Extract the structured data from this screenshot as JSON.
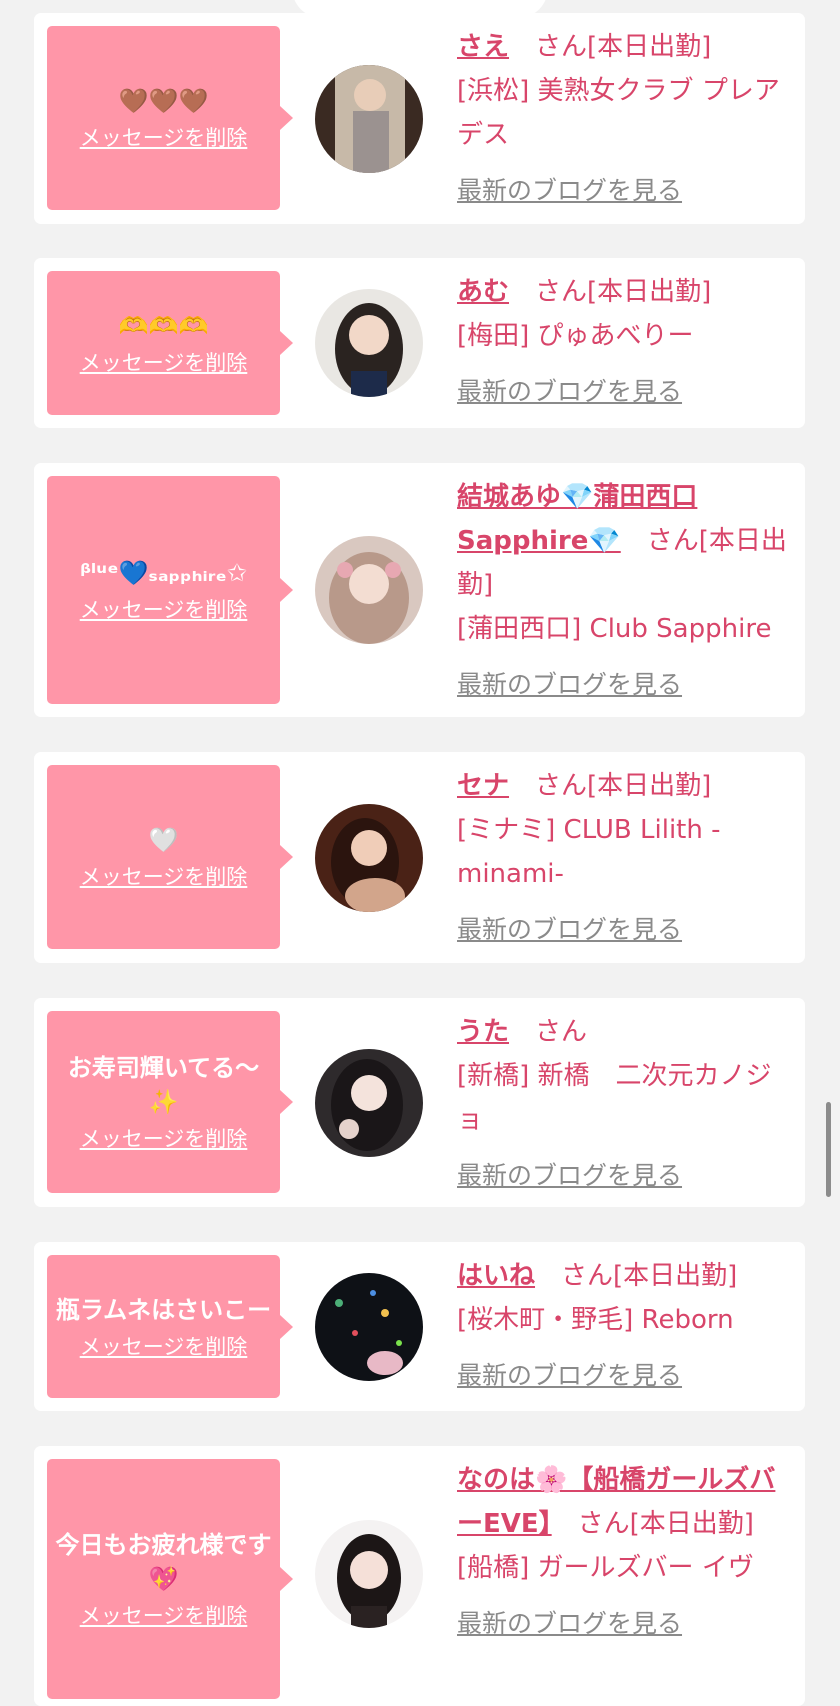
{
  "cards": [
    {
      "message": "🤎🤎🤎",
      "delete_label": "メッセージを削除",
      "name": "さえ",
      "suffix": "　さん[本日出勤]",
      "shop": "[浜松] 美熟女クラブ プレアデス",
      "blog_label": "最新のブログを見る"
    },
    {
      "message": "🫶🫶🫶",
      "delete_label": "メッセージを削除",
      "name": "あむ",
      "suffix": "　さん[本日出勤]",
      "shop": "[梅田] ぴゅあべりー",
      "blog_label": "最新のブログを見る"
    },
    {
      "message": "ᵝˡᵘᵉ💙ₛₐₚₚₕᵢᵣₑ✩",
      "delete_label": "メッセージを削除",
      "name": "結城あゆ💎蒲田西口Sapphire💎",
      "suffix": "　さん[本日出勤]",
      "shop": "[蒲田西口] Club Sapphire",
      "blog_label": "最新のブログを見る"
    },
    {
      "message": "🤍",
      "delete_label": "メッセージを削除",
      "name": "セナ",
      "suffix": "　さん[本日出勤]",
      "shop": "[ミナミ] CLUB Lilith -minami-",
      "blog_label": "最新のブログを見る"
    },
    {
      "message": "お寿司輝いてる〜✨",
      "delete_label": "メッセージを削除",
      "name": "うた",
      "suffix": "　さん",
      "shop": "[新橋] 新橋　二次元カノジョ",
      "blog_label": "最新のブログを見る"
    },
    {
      "message": "瓶ラムネはさいこー",
      "delete_label": "メッセージを削除",
      "name": "はいね",
      "suffix": "　さん[本日出勤]",
      "shop": "[桜木町・野毛] Reborn",
      "blog_label": "最新のブログを見る"
    },
    {
      "message": "今日もお疲れ様です💖",
      "delete_label": "メッセージを削除",
      "name": "なのは🌸【船橋ガールズバーEVE】",
      "suffix": "　さん[本日出勤]",
      "shop": "[船橋] ガールズバー イヴ",
      "blog_label": "最新のブログを見る"
    }
  ]
}
